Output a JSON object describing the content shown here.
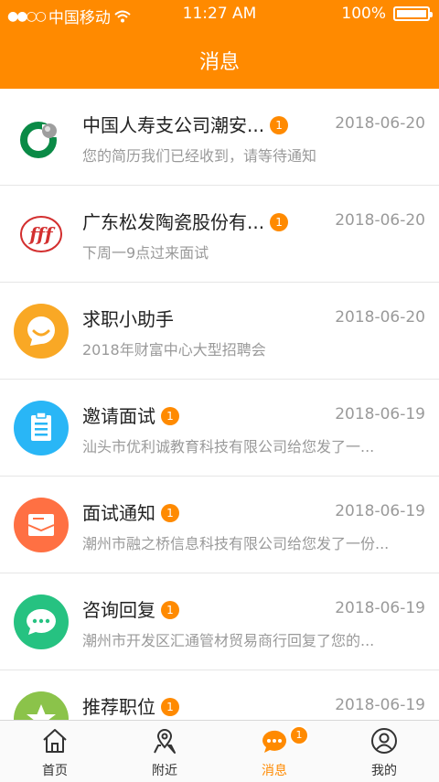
{
  "status_bar": {
    "signal_dots": "●●○○",
    "carrier": "中国移动",
    "time": "11:27 AM",
    "battery": "100%"
  },
  "header": {
    "title": "消息"
  },
  "messages": [
    {
      "name": "中国人寿支公司潮安...",
      "badge": "1",
      "date": "2018-06-20",
      "preview": "您的简历我们已经收到，请等待通知",
      "icon": "china-life-logo"
    },
    {
      "name": "广东松发陶瓷股份有...",
      "badge": "1",
      "date": "2018-06-20",
      "preview": "下周一9点过来面试",
      "icon": "songfa-logo"
    },
    {
      "name": "求职小助手",
      "badge": "",
      "date": "2018-06-20",
      "preview": "2018年财富中心大型招聘会",
      "icon": "smile-icon",
      "color": "#f9a825"
    },
    {
      "name": "邀请面试",
      "badge": "1",
      "date": "2018-06-19",
      "preview": "汕头市优利诚教育科技有限公司给您发了一...",
      "icon": "clipboard-icon",
      "color": "#29b6f6"
    },
    {
      "name": "面试通知",
      "badge": "1",
      "date": "2018-06-19",
      "preview": "潮州市融之桥信息科技有限公司给您发了一份...",
      "icon": "envelope-icon",
      "color": "#ff7043"
    },
    {
      "name": "咨询回复",
      "badge": "1",
      "date": "2018-06-19",
      "preview": "潮州市开发区汇通管材贸易商行回复了您的...",
      "icon": "chat-icon",
      "color": "#26c281"
    },
    {
      "name": "推荐职位",
      "badge": "1",
      "date": "2018-06-19",
      "preview": "",
      "icon": "star-icon",
      "color": "#8bc34a"
    }
  ],
  "tabs": [
    {
      "label": "首页",
      "icon": "home-icon"
    },
    {
      "label": "附近",
      "icon": "location-icon"
    },
    {
      "label": "消息",
      "icon": "message-icon",
      "badge": "1",
      "active": true
    },
    {
      "label": "我的",
      "icon": "profile-icon"
    }
  ],
  "colors": {
    "accent": "#ff8a00",
    "muted_text": "#9a9a9a"
  }
}
